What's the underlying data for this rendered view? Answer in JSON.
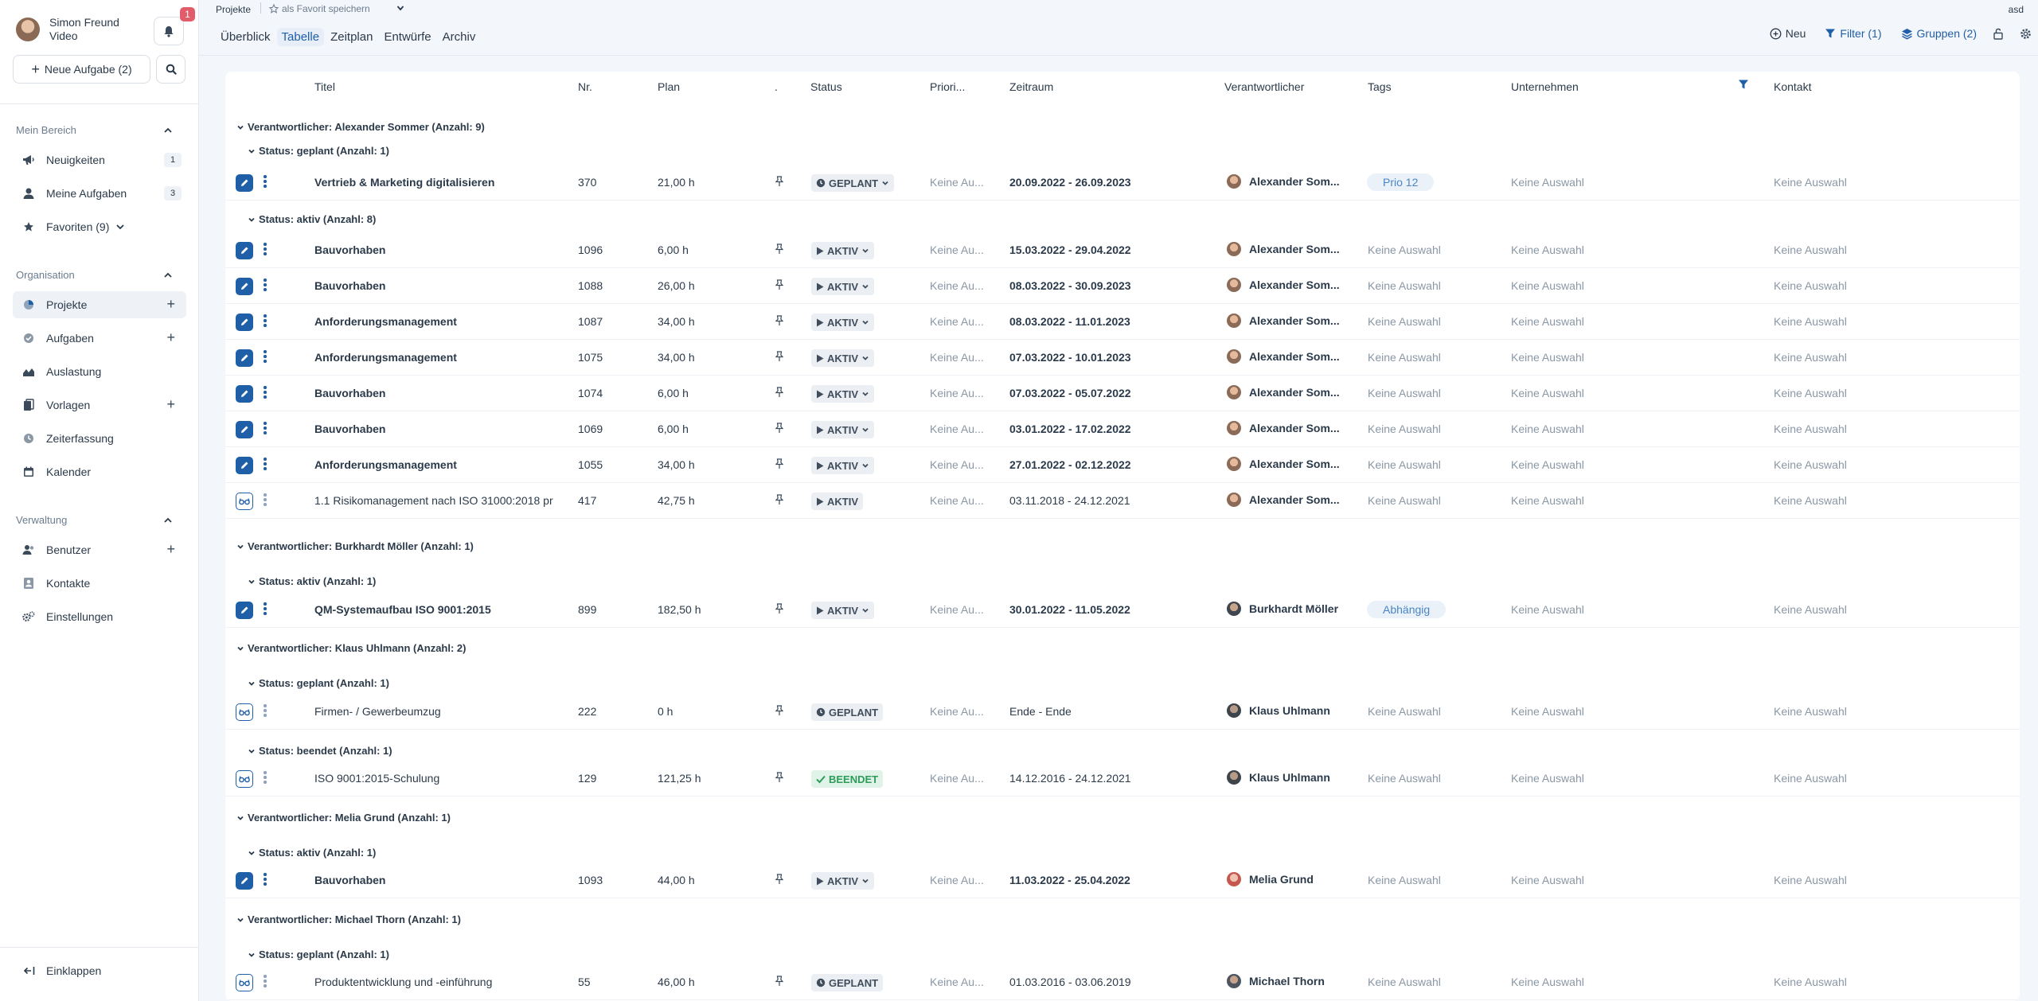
{
  "user": {
    "name": "Simon Freund",
    "subtitle": "Video"
  },
  "notifications": {
    "count": "1"
  },
  "sidebar": {
    "new_task_label": "Neue Aufgabe (2)",
    "sections": [
      {
        "title": "Mein Bereich"
      },
      {
        "title": "Organisation"
      },
      {
        "title": "Verwaltung"
      }
    ],
    "items": [
      {
        "label": "Neuigkeiten",
        "count": "1"
      },
      {
        "label": "Meine Aufgaben",
        "count": "3"
      },
      {
        "label": "Favoriten (9)"
      },
      {
        "label": "Projekte"
      },
      {
        "label": "Aufgaben"
      },
      {
        "label": "Auslastung"
      },
      {
        "label": "Vorlagen"
      },
      {
        "label": "Zeiterfassung"
      },
      {
        "label": "Kalender"
      },
      {
        "label": "Benutzer"
      },
      {
        "label": "Kontakte"
      },
      {
        "label": "Einstellungen"
      }
    ],
    "collapse_label": "Einklappen"
  },
  "topbar": {
    "breadcrumb": "Projekte",
    "favorite_label": "als Favorit speichern",
    "account": "asd",
    "tabs": [
      "Überblick",
      "Tabelle",
      "Zeitplan",
      "Entwürfe",
      "Archiv"
    ],
    "active_tab": "Tabelle",
    "new_label": "Neu",
    "filter_label": "Filter (1)",
    "groups_label": "Gruppen (2)"
  },
  "table": {
    "columns": [
      "Titel",
      "Nr.",
      "Plan",
      ".",
      "Status",
      "Priori...",
      "Zeitraum",
      "Verantwortlicher",
      "Tags",
      "Unternehmen",
      "Kontakt"
    ],
    "group1": [
      "Verantwortlicher: Alexander Sommer (Anzahl: 9)",
      "Verantwortlicher: Burkhardt Möller (Anzahl: 1)",
      "Verantwortlicher: Klaus Uhlmann (Anzahl: 2)",
      "Verantwortlicher: Melia Grund (Anzahl: 1)",
      "Verantwortlicher: Michael Thorn (Anzahl: 1)"
    ],
    "group2": [
      "Status: geplant (Anzahl: 1)",
      "Status: aktiv (Anzahl: 8)",
      "Status: aktiv (Anzahl: 1)",
      "Status: geplant (Anzahl: 1)",
      "Status: beendet (Anzahl: 1)",
      "Status: aktiv (Anzahl: 1)",
      "Status: geplant (Anzahl: 1)"
    ],
    "rows": [
      {
        "title": "Vertrieb & Marketing digitalisieren",
        "nr": "370",
        "plan": "21,00 h",
        "status": "GEPLANT",
        "priority": "Keine Au...",
        "period": "20.09.2022 - 26.09.2023",
        "owner": "Alexander Som...",
        "tag": "Prio 12",
        "company": "Keine Auswahl",
        "contact": "Keine Auswahl"
      },
      {
        "title": "Bauvorhaben",
        "nr": "1096",
        "plan": "6,00 h",
        "status": "AKTIV",
        "priority": "Keine Au...",
        "period": "15.03.2022 - 29.04.2022",
        "owner": "Alexander Som...",
        "tag": "Keine Auswahl",
        "company": "Keine Auswahl",
        "contact": "Keine Auswahl"
      },
      {
        "title": "Bauvorhaben",
        "nr": "1088",
        "plan": "26,00 h",
        "status": "AKTIV",
        "priority": "Keine Au...",
        "period": "08.03.2022 - 30.09.2023",
        "owner": "Alexander Som...",
        "tag": "Keine Auswahl",
        "company": "Keine Auswahl",
        "contact": "Keine Auswahl"
      },
      {
        "title": "Anforderungsmanagement",
        "nr": "1087",
        "plan": "34,00 h",
        "status": "AKTIV",
        "priority": "Keine Au...",
        "period": "08.03.2022 - 11.01.2023",
        "owner": "Alexander Som...",
        "tag": "Keine Auswahl",
        "company": "Keine Auswahl",
        "contact": "Keine Auswahl"
      },
      {
        "title": "Anforderungsmanagement",
        "nr": "1075",
        "plan": "34,00 h",
        "status": "AKTIV",
        "priority": "Keine Au...",
        "period": "07.03.2022 - 10.01.2023",
        "owner": "Alexander Som...",
        "tag": "Keine Auswahl",
        "company": "Keine Auswahl",
        "contact": "Keine Auswahl"
      },
      {
        "title": "Bauvorhaben",
        "nr": "1074",
        "plan": "6,00 h",
        "status": "AKTIV",
        "priority": "Keine Au...",
        "period": "07.03.2022 - 05.07.2022",
        "owner": "Alexander Som...",
        "tag": "Keine Auswahl",
        "company": "Keine Auswahl",
        "contact": "Keine Auswahl"
      },
      {
        "title": "Bauvorhaben",
        "nr": "1069",
        "plan": "6,00 h",
        "status": "AKTIV",
        "priority": "Keine Au...",
        "period": "03.01.2022 - 17.02.2022",
        "owner": "Alexander Som...",
        "tag": "Keine Auswahl",
        "company": "Keine Auswahl",
        "contact": "Keine Auswahl"
      },
      {
        "title": "Anforderungsmanagement",
        "nr": "1055",
        "plan": "34,00 h",
        "status": "AKTIV",
        "priority": "Keine Au...",
        "period": "27.01.2022 - 02.12.2022",
        "owner": "Alexander Som...",
        "tag": "Keine Auswahl",
        "company": "Keine Auswahl",
        "contact": "Keine Auswahl"
      },
      {
        "title": "1.1 Risikomanagement nach ISO 31000:2018 pr",
        "nr": "417",
        "plan": "42,75 h",
        "status": "AKTIV",
        "priority": "Keine Au...",
        "period": "03.11.2018 - 24.12.2021",
        "owner": "Alexander Som...",
        "tag": "Keine Auswahl",
        "company": "Keine Auswahl",
        "contact": "Keine Auswahl"
      },
      {
        "title": "QM-Systemaufbau ISO 9001:2015",
        "nr": "899",
        "plan": "182,50 h",
        "status": "AKTIV",
        "priority": "Keine Au...",
        "period": "30.01.2022 - 11.05.2022",
        "owner": "Burkhardt Möller",
        "tag": "Abhängig",
        "company": "Keine Auswahl",
        "contact": "Keine Auswahl"
      },
      {
        "title": "Firmen- / Gewerbeumzug",
        "nr": "222",
        "plan": "0 h",
        "status": "GEPLANT",
        "priority": "Keine Au...",
        "period": "Ende - Ende",
        "owner": "Klaus Uhlmann",
        "tag": "Keine Auswahl",
        "company": "Keine Auswahl",
        "contact": "Keine Auswahl"
      },
      {
        "title": "ISO 9001:2015-Schulung",
        "nr": "129",
        "plan": "121,25 h",
        "status": "BEENDET",
        "priority": "Keine Au...",
        "period": "14.12.2016 - 24.12.2021",
        "owner": "Klaus Uhlmann",
        "tag": "Keine Auswahl",
        "company": "Keine Auswahl",
        "contact": "Keine Auswahl"
      },
      {
        "title": "Bauvorhaben",
        "nr": "1093",
        "plan": "44,00 h",
        "status": "AKTIV",
        "priority": "Keine Au...",
        "period": "11.03.2022 - 25.04.2022",
        "owner": "Melia Grund",
        "tag": "Keine Auswahl",
        "company": "Keine Auswahl",
        "contact": "Keine Auswahl"
      },
      {
        "title": "Produktentwicklung und -einführung",
        "nr": "55",
        "plan": "46,00 h",
        "status": "GEPLANT",
        "priority": "Keine Au...",
        "period": "01.03.2016 - 03.06.2019",
        "owner": "Michael Thorn",
        "tag": "Keine Auswahl",
        "company": "Keine Auswahl",
        "contact": "Keine Auswahl"
      }
    ]
  },
  "colors": {
    "accent": "#1f5fa8",
    "badge": "#e25d6b",
    "done": "#2d9c5a"
  }
}
